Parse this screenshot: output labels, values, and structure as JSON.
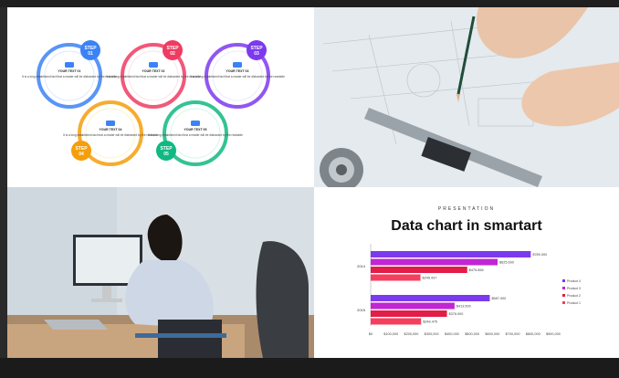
{
  "panel_infographic": {
    "steps": [
      {
        "step_label": "STEP",
        "step_num": "01",
        "title": "YOUR TEXT 01",
        "body": "It is a long established fact that a reader will be distracted by the readable",
        "color": "#3b82f6"
      },
      {
        "step_label": "STEP",
        "step_num": "02",
        "title": "YOUR TEXT 02",
        "body": "It is a long established fact that a reader will be distracted by the readable",
        "color": "#ef3b63"
      },
      {
        "step_label": "STEP",
        "step_num": "03",
        "title": "YOUR TEXT 03",
        "body": "It is a long established fact that a reader will be distracted by the readable",
        "color": "#7c3aed"
      },
      {
        "step_label": "STEP",
        "step_num": "04",
        "title": "YOUR TEXT 04",
        "body": "It is a long established fact that a reader will be distracted by the readable",
        "color": "#f59e0b"
      },
      {
        "step_label": "STEP",
        "step_num": "05",
        "title": "YOUR TEXT 05",
        "body": "It is a long established fact that a reader will be distracted by the readable",
        "color": "#10b981"
      }
    ]
  },
  "panel_chart": {
    "subtitle": "PRESENTATION",
    "title": "Data chart in smartart"
  },
  "chart_data": {
    "type": "bar",
    "orientation": "horizontal",
    "categories": [
      "2014",
      "2015"
    ],
    "series": [
      {
        "name": "Product 4",
        "values": [
          789000,
          587000
        ],
        "color": "#7c3aed"
      },
      {
        "name": "Product 3",
        "values": [
          625690,
          413500
        ],
        "color": "#c026d3"
      },
      {
        "name": "Product 2",
        "values": [
          475856,
          376000
        ],
        "color": "#e11d48"
      },
      {
        "name": "Product 1",
        "values": [
          245437,
          248475
        ],
        "color": "#f43f5e"
      }
    ],
    "value_labels": [
      [
        "$789.000",
        "$625.690",
        "$475.856",
        "$245.437"
      ],
      [
        "$587.000",
        "$413.500",
        "$376.000",
        "$248.475"
      ]
    ],
    "xticks": [
      "$0",
      "$100,000",
      "$200,000",
      "$300,000",
      "$400,000",
      "$500,000",
      "$600,000",
      "$700,000",
      "$800,000",
      "$900,000"
    ],
    "xlim": [
      0,
      900000
    ],
    "legend_position": "right",
    "grid": false
  }
}
